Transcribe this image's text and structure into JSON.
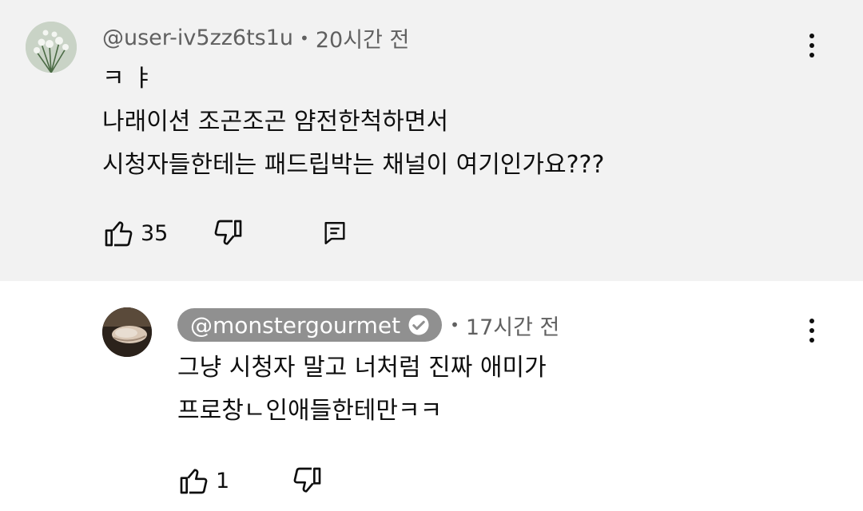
{
  "comments": [
    {
      "author": "@user-iv5zz6ts1u",
      "time": "20시간 전",
      "lines": [
        "ㅋ ㅑ",
        "나래이션 조곤조곤 얌전한척하면서",
        "시청자들한테는 패드립박는 채널이 여기인가요???"
      ],
      "like_count": "35",
      "icons": [
        "avatar-flower",
        "thumb-up-icon",
        "thumb-down-icon",
        "reply-icon",
        "more-vert-icon"
      ]
    },
    {
      "author": "@monstergourmet",
      "verified": true,
      "time": "17시간 전",
      "lines": [
        "그냥 시청자 말고 너처럼 진짜 애미가",
        "프로창ㄴ인애들한테만ㅋㅋ"
      ],
      "like_count": "1",
      "icons": [
        "avatar-food",
        "verified-check-icon",
        "thumb-up-icon",
        "thumb-down-icon",
        "more-vert-icon"
      ]
    }
  ],
  "colors": {
    "parent_bg": "#f2f2f2",
    "reply_bg": "#ffffff",
    "meta_text": "#606060",
    "channel_pill_bg": "#909090",
    "text": "#0f0f0f"
  }
}
